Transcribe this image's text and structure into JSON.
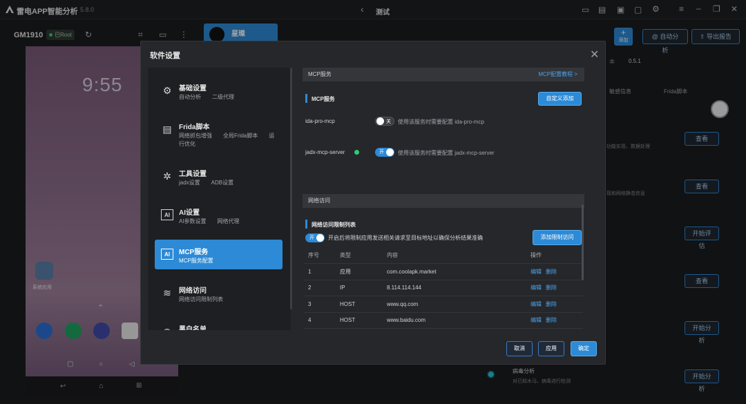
{
  "app": {
    "title": "雷电APP智能分析",
    "version": "5.8.0",
    "page_title": "测试"
  },
  "device": {
    "name": "GM1910",
    "root_badge": "已Root",
    "clock": "9:55",
    "home_app_label": "系统应用"
  },
  "background_panel": {
    "top_actions": {
      "add_label": "添加",
      "auto_label": "自动分析",
      "export_label": "导出报告"
    },
    "tab_label": "星璨",
    "version_label": "本",
    "version_value": "0.5.1",
    "tabs": [
      "敏感信息",
      "Frida脚本"
    ],
    "rows": [
      {
        "desc": "功能实现、数据处理",
        "button": "查看"
      },
      {
        "desc": "现和网络静态信息",
        "button": "查看"
      },
      {
        "desc": "",
        "button": "开始评估"
      },
      {
        "desc": "",
        "button": "查看"
      },
      {
        "desc": "",
        "button": "开始分析"
      },
      {
        "title": "病毒分析",
        "desc": "对已知木马、病毒进行检测",
        "button": "开始分析"
      }
    ]
  },
  "dialog": {
    "title": "软件设置",
    "sidebar": [
      {
        "title": "基础设置",
        "subtitle": "自动分析　　二级代理",
        "icon": "gear-icon"
      },
      {
        "title": "Frida脚本",
        "subtitle": "网络抓包增强　　全局Frida脚本　　运行优化",
        "icon": "script-icon"
      },
      {
        "title": "工具设置",
        "subtitle": "jadx设置　　ADB设置",
        "icon": "tools-icon"
      },
      {
        "title": "AI设置",
        "subtitle": "AI参数设置　　网络代理",
        "icon": "ai-icon"
      },
      {
        "title": "MCP服务",
        "subtitle": "MCP服务配置",
        "icon": "ai-icon",
        "active": true
      },
      {
        "title": "网络访问",
        "subtitle": "网络访问限制列表",
        "icon": "wifi-icon"
      },
      {
        "title": "黑白名单",
        "subtitle": "",
        "icon": "list-icon"
      }
    ],
    "mcp": {
      "header": "MCP服务",
      "tutorial_link": "MCP配置教程 >",
      "section_title": "MCP服务",
      "add_button": "自定义添加",
      "services": [
        {
          "name": "ida-pro-mcp",
          "toggle_label": "关",
          "enabled": false,
          "hint": "使用该服务时需要配置 ida-pro-mcp"
        },
        {
          "name": "jadx-mcp-server",
          "toggle_label": "开",
          "enabled": true,
          "hint": "使用该服务时需要配置 jadx-mcp-server"
        }
      ]
    },
    "network": {
      "header": "网络访问",
      "section_title": "网络访问限制列表",
      "toggle_label": "开",
      "toggle_hint": "开启后将限制应用发送相关请求至目标地址以确保分析结果准确",
      "add_button": "添加限制访问",
      "columns": [
        "序号",
        "类型",
        "内容",
        "操作"
      ],
      "rows": [
        {
          "no": "1",
          "type": "应用",
          "content": "com.coolapk.market"
        },
        {
          "no": "2",
          "type": "IP",
          "content": "8.114.114.144"
        },
        {
          "no": "3",
          "type": "HOST",
          "content": "www.qq.com"
        },
        {
          "no": "4",
          "type": "HOST",
          "content": "www.baidu.com"
        }
      ],
      "edit_label": "编辑",
      "delete_label": "删除"
    },
    "footer": {
      "cancel": "取消",
      "apply": "应用",
      "ok": "确定"
    }
  },
  "colors": {
    "accent": "#2d8ad6",
    "success": "#2ecc71"
  }
}
